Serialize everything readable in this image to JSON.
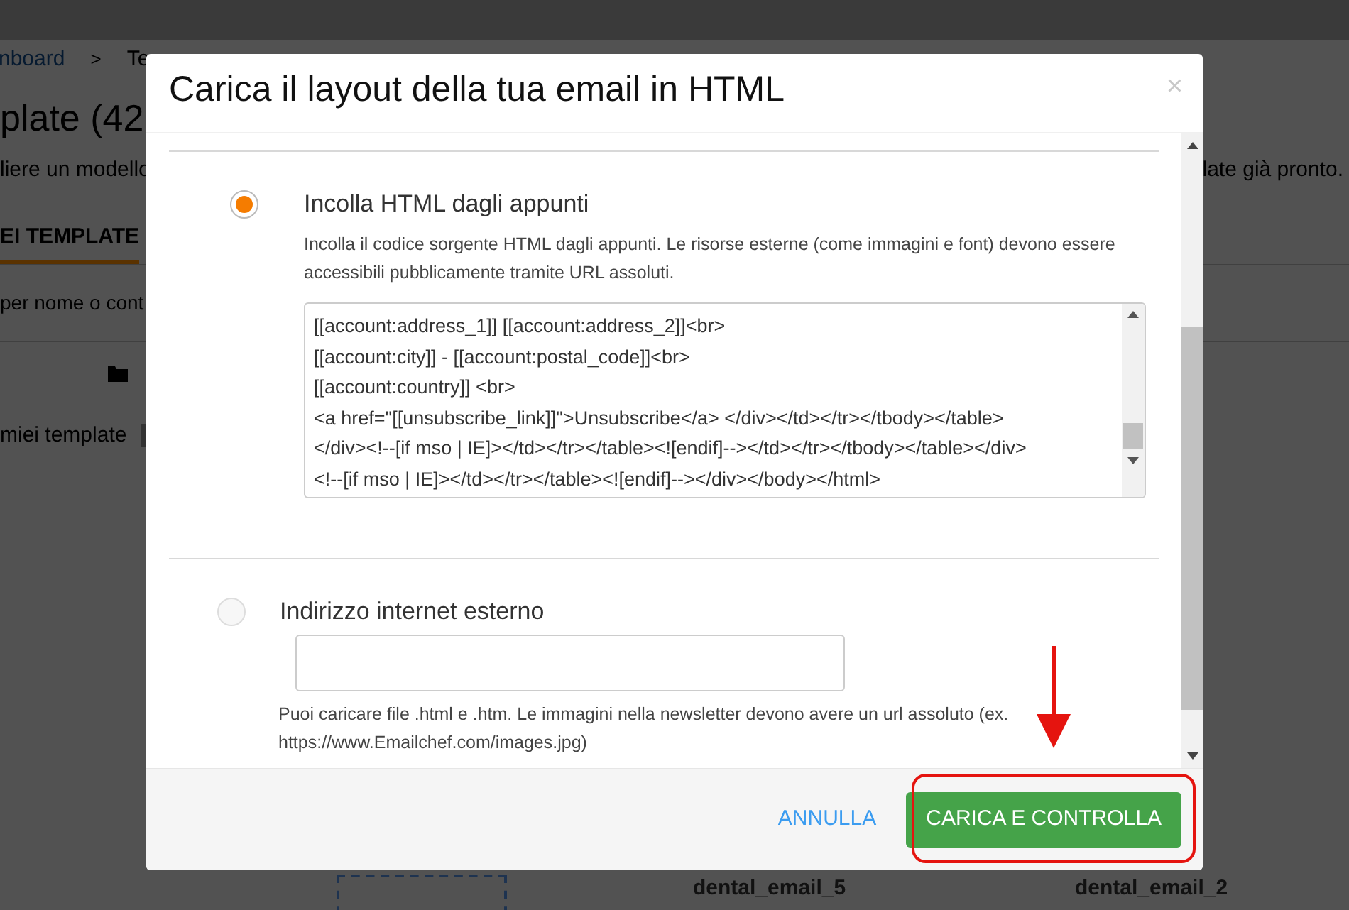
{
  "background": {
    "breadcrumb": [
      "nboard",
      "Te"
    ],
    "breadcrumb_separator": ">",
    "heading": "plate (42",
    "intro_left": "liere un modello",
    "intro_right": "late già pronto.",
    "tab": "EI TEMPLATE",
    "search_placeholder": "per nome o cont",
    "folder_label": "miei template",
    "cards": [
      "dental_email_5",
      "dental_email_2"
    ]
  },
  "modal": {
    "title": "Carica il layout della tua email in HTML",
    "close": "×",
    "options": [
      {
        "kind": "paste",
        "selected": true,
        "label": "Incolla HTML dagli appunti",
        "description": "Incolla il codice sorgente HTML dagli appunti. Le risorse esterne (come immagini e font) devono essere accessibili pubblicamente tramite URL assoluti.",
        "code_lines": [
          "[[account:address_1]] [[account:address_2]]<br>",
          "[[account:city]] - [[account:postal_code]]<br>",
          "[[account:country]] <br>",
          "<a href=\"[[unsubscribe_link]]\">Unsubscribe</a> </div></td></tr></tbody></table>",
          "</div><!--[if mso | IE]></td></tr></table><![endif]--></td></tr></tbody></table></div>",
          "<!--[if mso | IE]></td></tr></table><![endif]--></div></body></html>"
        ]
      },
      {
        "kind": "url",
        "selected": false,
        "label": "Indirizzo internet esterno",
        "help": [
          "Puoi caricare file .html e .htm. Le immagini nella newsletter devono avere un url assoluto (ex.",
          "https://www.Emailchef.com/images.jpg)"
        ]
      }
    ],
    "buttons": [
      {
        "kind": "link",
        "label": "ANNULLA"
      },
      {
        "kind": "primary",
        "label": "CARICA E CONTROLLA"
      }
    ]
  }
}
